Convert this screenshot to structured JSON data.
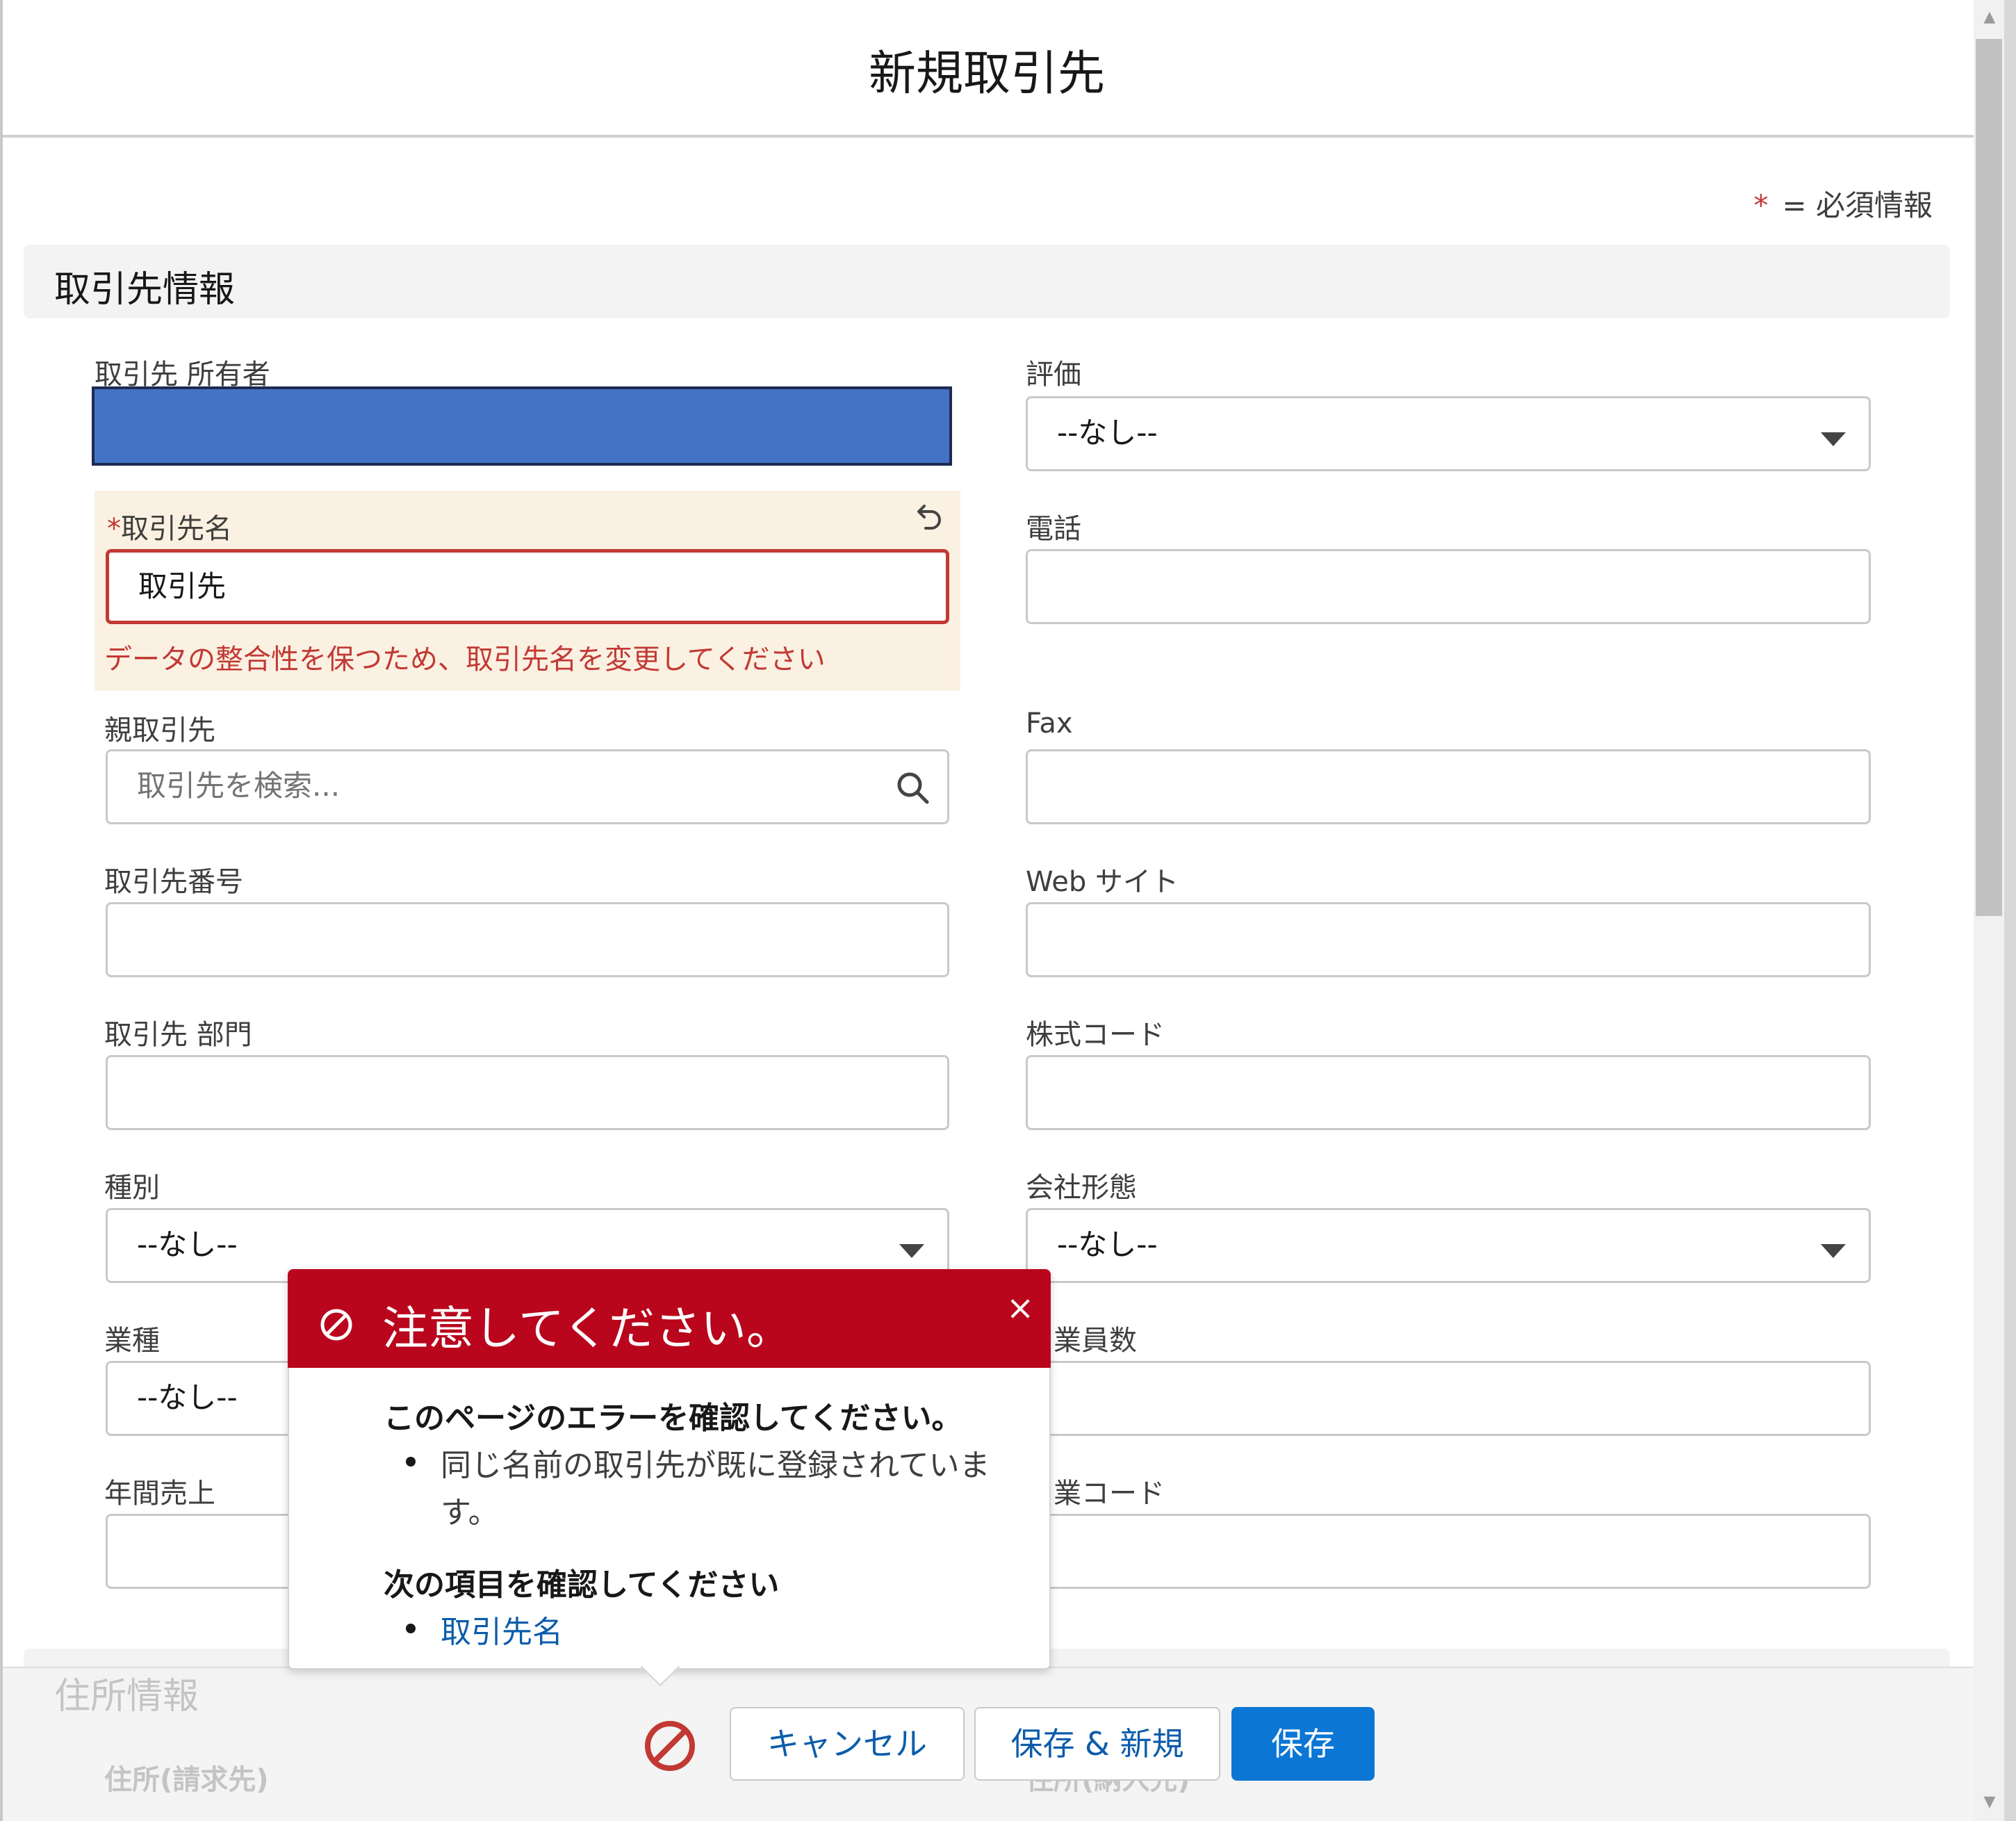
{
  "modal": {
    "title": "新規取引先",
    "required_star": "*",
    "required_note": "= 必須情報"
  },
  "section": {
    "title": "取引先情報"
  },
  "fields": {
    "owner_label": "取引先 所有者",
    "account_name_label": "取引先名",
    "account_name_value": "取引先",
    "account_name_error": "データの整合性を保つため、取引先名を変更してください",
    "parent_label": "親取引先",
    "parent_placeholder": "取引先を検索...",
    "account_number_label": "取引先番号",
    "site_label": "取引先 部門",
    "type_label": "種別",
    "type_value": "--なし--",
    "industry_label": "業種",
    "industry_value": "--なし--",
    "revenue_label": "年間売上",
    "rating_label": "評価",
    "rating_value": "--なし--",
    "phone_label": "電話",
    "fax_label": "Fax",
    "website_label": "Web サイト",
    "ticker_label": "株式コード",
    "ownership_label": "会社形態",
    "ownership_value": "--なし--",
    "employees_label": "業員数",
    "sic_label": "業コード"
  },
  "popover": {
    "title": "注意してください。",
    "close": "×",
    "page_errors_heading": "このページのエラーを確認してください。",
    "page_error_line1": "同じ名前の取引先が既に登録されていま",
    "page_error_line2": "す。",
    "field_errors_heading": "次の項目を確認してください",
    "field_error_link": "取引先名"
  },
  "footer": {
    "address_section": "住所情報",
    "billing_address": "住所(請求先)",
    "shipping_address": "住所(納入先)",
    "cancel": "キャンセル",
    "save_new": "保存 & 新規",
    "save": "保存"
  },
  "colors": {
    "error": "#c23934",
    "popover_header": "#b9061c",
    "brand": "#0b76d4",
    "link": "#0b5cab",
    "owner_redaction": "#4472c4"
  }
}
